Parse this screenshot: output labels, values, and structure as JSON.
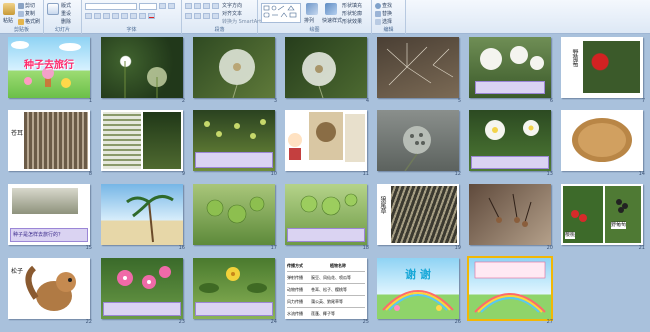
{
  "ribbon": {
    "groups": [
      {
        "label": "剪贴板"
      },
      {
        "label": "幻灯片"
      },
      {
        "label": "字体"
      },
      {
        "label": "段落"
      },
      {
        "label": "绘图"
      },
      {
        "label": "编辑"
      }
    ],
    "buttons": {
      "paste": "粘贴",
      "cut": "剪切",
      "copy": "复制",
      "format_painter": "格式刷",
      "new_slide": "新建幻灯片",
      "layout": "版式",
      "reset": "重设",
      "delete": "删除",
      "text_direction": "文字方向",
      "align_text": "对齐文本",
      "smartart": "转换为 SmartArt",
      "arrange": "排列",
      "quick_styles": "快速样式",
      "shape_fill": "形状填充",
      "shape_outline": "形状轮廓",
      "shape_effects": "形状效果",
      "find": "查找",
      "replace": "替换",
      "select": "选择"
    }
  },
  "slides": [
    {
      "number": "1",
      "title": "种子去旅行"
    },
    {
      "number": "2"
    },
    {
      "number": "3"
    },
    {
      "number": "4"
    },
    {
      "number": "5"
    },
    {
      "number": "6"
    },
    {
      "number": "7",
      "label": "野葡萄"
    },
    {
      "number": "8",
      "label": "苍耳"
    },
    {
      "number": "9"
    },
    {
      "number": "10"
    },
    {
      "number": "11"
    },
    {
      "number": "12"
    },
    {
      "number": "13"
    },
    {
      "number": "14"
    },
    {
      "number": "15",
      "text": "种子是怎样去旅行的？"
    },
    {
      "number": "16"
    },
    {
      "number": "17"
    },
    {
      "number": "18"
    },
    {
      "number": "19",
      "label": "狼尾草"
    },
    {
      "number": "20"
    },
    {
      "number": "21",
      "label": "野葡萄",
      "label2": "樱桃"
    },
    {
      "number": "22",
      "label": "松子"
    },
    {
      "number": "23"
    },
    {
      "number": "24"
    },
    {
      "number": "25",
      "table_header": [
        "传播方式",
        "植物名称"
      ],
      "table_rows": [
        [
          "弹射传播",
          "豌豆、凤仙花、喷瓜等"
        ],
        [
          "动物传播",
          "苍耳、松子、樱桃等"
        ],
        [
          "风力传播",
          "蒲公英、狼尾草等"
        ],
        [
          "水流传播",
          "莲蓬、椰子等"
        ]
      ]
    },
    {
      "number": "26",
      "title": "谢  谢"
    },
    {
      "number": "27"
    }
  ],
  "colors": {
    "sorter_bg": "#a9c1dc",
    "selection": "#f2b705",
    "ribbon": "#dde8f5"
  }
}
